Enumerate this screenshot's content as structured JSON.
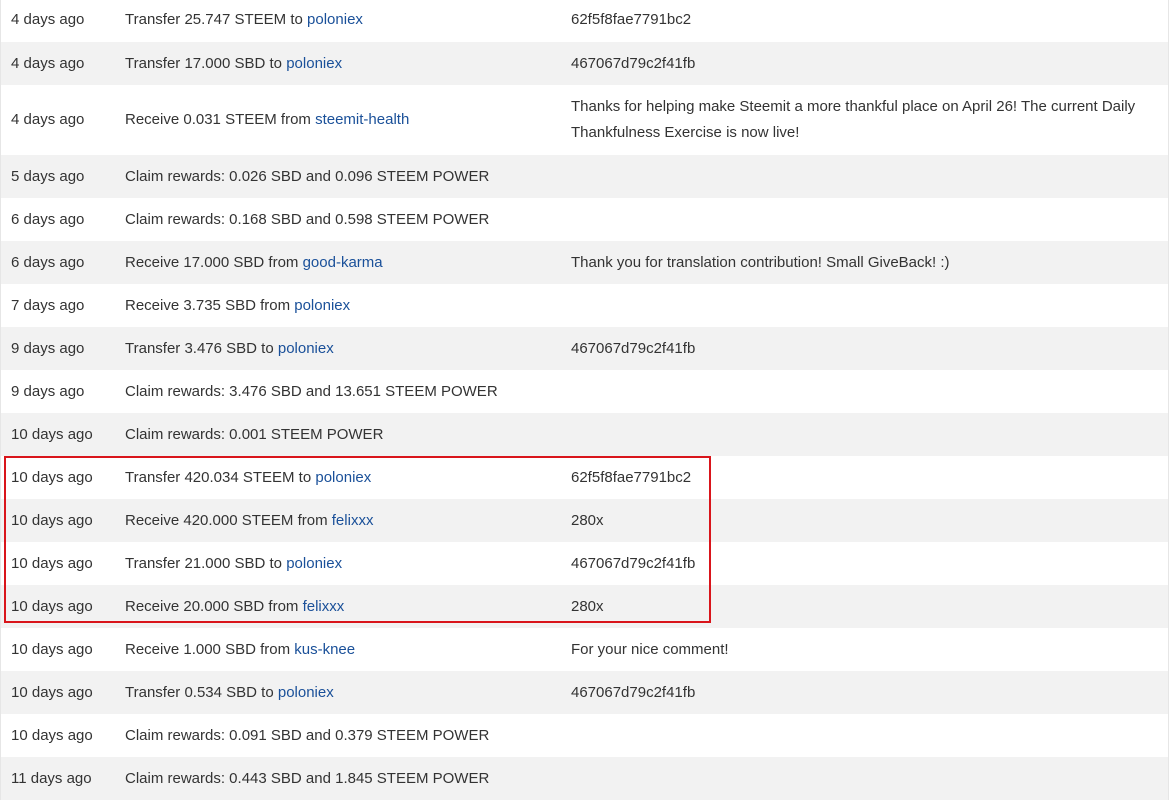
{
  "colors": {
    "link": "#1a5099",
    "row_alt": "#f2f2f2",
    "highlight_border": "#d9151b"
  },
  "rows": [
    {
      "date": "4 days ago",
      "text": "Transfer 25.747 STEEM to ",
      "user": "poloniex",
      "memo": "62f5f8fae7791bc2"
    },
    {
      "date": "4 days ago",
      "text": "Transfer 17.000 SBD to ",
      "user": "poloniex",
      "memo": "467067d79c2f41fb"
    },
    {
      "date": "4 days ago",
      "text": "Receive 0.031 STEEM from ",
      "user": "steemit-health",
      "memo": "Thanks for helping make Steemit a more thankful place on April 26! The current Daily Thankfulness Exercise is now live!"
    },
    {
      "date": "5 days ago",
      "text": "Claim rewards: 0.026 SBD and 0.096 STEEM POWER",
      "user": "",
      "memo": ""
    },
    {
      "date": "6 days ago",
      "text": "Claim rewards: 0.168 SBD and 0.598 STEEM POWER",
      "user": "",
      "memo": ""
    },
    {
      "date": "6 days ago",
      "text": "Receive 17.000 SBD from ",
      "user": "good-karma",
      "memo": "Thank you for translation contribution! Small GiveBack! :)"
    },
    {
      "date": "7 days ago",
      "text": "Receive 3.735 SBD from ",
      "user": "poloniex",
      "memo": ""
    },
    {
      "date": "9 days ago",
      "text": "Transfer 3.476 SBD to ",
      "user": "poloniex",
      "memo": "467067d79c2f41fb"
    },
    {
      "date": "9 days ago",
      "text": "Claim rewards: 3.476 SBD and 13.651 STEEM POWER",
      "user": "",
      "memo": ""
    },
    {
      "date": "10 days ago",
      "text": "Claim rewards: 0.001 STEEM POWER",
      "user": "",
      "memo": ""
    },
    {
      "date": "10 days ago",
      "text": "Transfer 420.034 STEEM to ",
      "user": "poloniex",
      "memo": "62f5f8fae7791bc2"
    },
    {
      "date": "10 days ago",
      "text": "Receive 420.000 STEEM from ",
      "user": "felixxx",
      "memo": "280x"
    },
    {
      "date": "10 days ago",
      "text": "Transfer 21.000 SBD to ",
      "user": "poloniex",
      "memo": "467067d79c2f41fb"
    },
    {
      "date": "10 days ago",
      "text": "Receive 20.000 SBD from ",
      "user": "felixxx",
      "memo": "280x"
    },
    {
      "date": "10 days ago",
      "text": "Receive 1.000 SBD from ",
      "user": "kus-knee",
      "memo": "For your nice comment!"
    },
    {
      "date": "10 days ago",
      "text": "Transfer 0.534 SBD to ",
      "user": "poloniex",
      "memo": "467067d79c2f41fb"
    },
    {
      "date": "10 days ago",
      "text": "Claim rewards: 0.091 SBD and 0.379 STEEM POWER",
      "user": "",
      "memo": ""
    },
    {
      "date": "11 days ago",
      "text": "Claim rewards: 0.443 SBD and 1.845 STEEM POWER",
      "user": "",
      "memo": ""
    }
  ]
}
